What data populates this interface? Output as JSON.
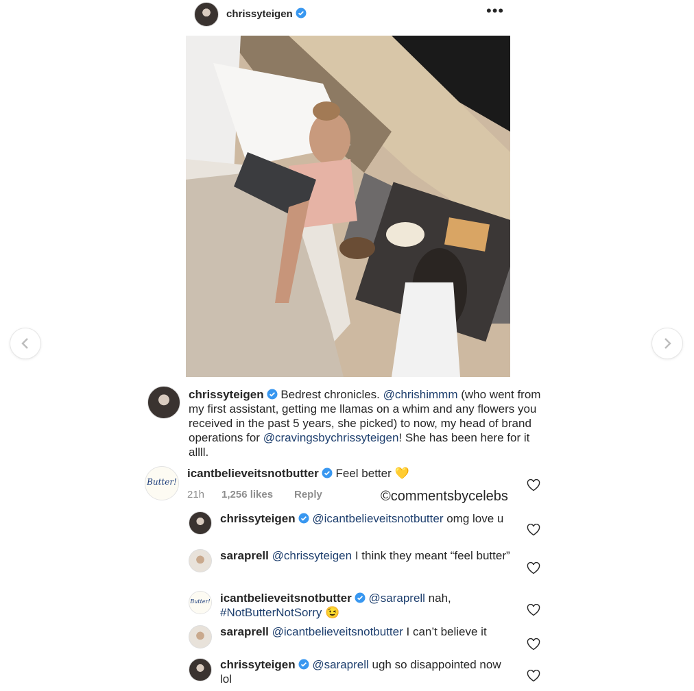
{
  "header": {
    "username": "chrissyteigen",
    "more_icon": "more-horizontal-icon"
  },
  "navigation": {
    "prev_icon": "chevron-left-icon",
    "next_icon": "chevron-right-icon"
  },
  "post": {
    "photo_icon": "photo-placeholder",
    "caption": {
      "username": "chrissyteigen",
      "text1": "Bedrest chronicles. ",
      "mention1": "@chrishimmm",
      "text2": " (who went from my first assistant, getting me llamas on a whim and any flowers you received in the past 5 years, she picked) to now, my head of brand operations for ",
      "mention2": "@cravingsbychrissyteigen",
      "text3": "! She has been here for it allll."
    }
  },
  "watermark": "©commentsbycelebs",
  "comments": [
    {
      "username": "icantbelieveitsnotbutter",
      "avatar_text": "Butter!",
      "text": "Feel better 💛",
      "time": "21h",
      "likes": "1,256 likes",
      "reply": "Reply"
    }
  ],
  "replies": [
    {
      "username": "chrissyteigen",
      "mention": "@icantbelieveitsnotbutter",
      "text": " omg love u"
    },
    {
      "username": "saraprell",
      "mention": "@chrissyteigen",
      "text": " I think they meant “feel butter”"
    },
    {
      "username": "icantbelieveitsnotbutter",
      "avatar_text": "Butter!",
      "mention": "@saraprell",
      "text": " nah, ",
      "hashtag": "#NotButterNotSorry",
      "emoji": " 😉"
    },
    {
      "username": "saraprell",
      "mention": "@icantbelieveitsnotbutter",
      "text": " I can’t believe it"
    },
    {
      "username": "chrissyteigen",
      "mention": "@saraprell",
      "text": " ugh so disappointed now lol"
    }
  ],
  "colors": {
    "verified": "#3897f0",
    "mention": "#1e3f6e",
    "meta": "#8e8e8e"
  }
}
